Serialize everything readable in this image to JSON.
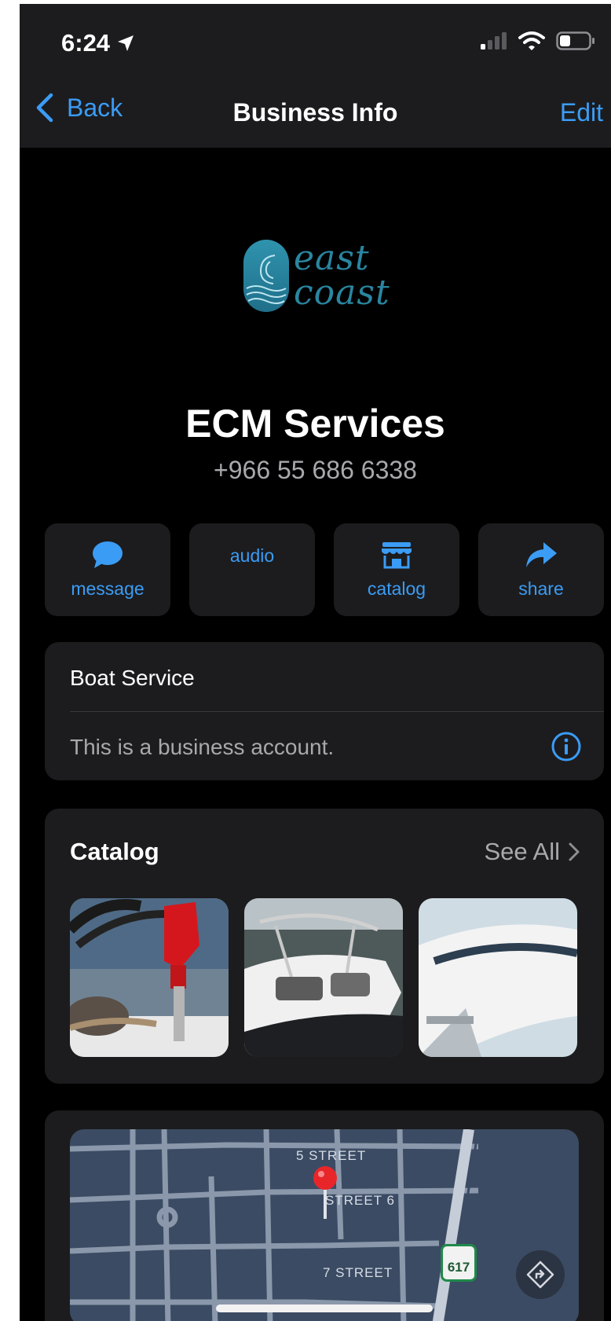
{
  "status_bar": {
    "time": "6:24"
  },
  "nav": {
    "back_label": "Back",
    "title": "Business Info",
    "edit_label": "Edit"
  },
  "business": {
    "logo_line1": "east",
    "logo_line2": "coast",
    "name": "ECM Services",
    "phone": "+966 55 686 6338"
  },
  "actions": [
    {
      "label": "message",
      "icon": "message-bubble-icon"
    },
    {
      "label": "audio",
      "icon": ""
    },
    {
      "label": "catalog",
      "icon": "storefront-icon"
    },
    {
      "label": "share",
      "icon": "share-arrow-icon"
    }
  ],
  "info": {
    "category": "Boat Service",
    "account_note": "This is a business account."
  },
  "catalog": {
    "title": "Catalog",
    "see_all": "See All"
  },
  "map": {
    "street_labels": [
      "5 STREET",
      "STREET 6",
      "7 STREET"
    ],
    "route_shield": "617"
  },
  "colors": {
    "accent": "#3b9cf5",
    "background": "#000000",
    "card": "#1c1c1e",
    "secondary_text": "#a8a8ad",
    "map_background": "#3b4b63",
    "pin": "#e8262a"
  }
}
